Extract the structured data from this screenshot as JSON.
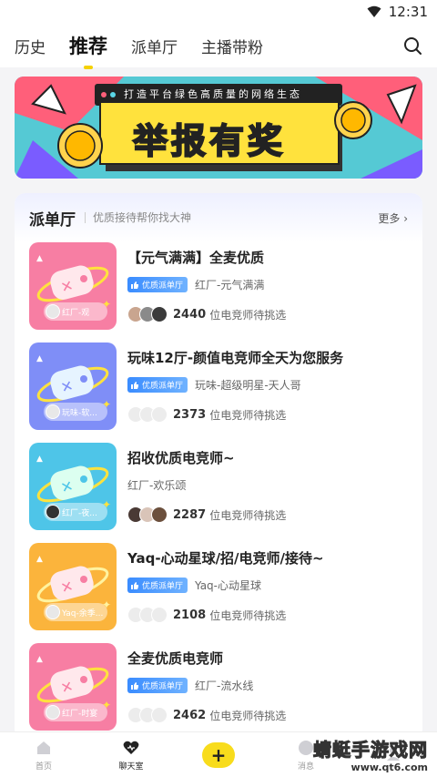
{
  "status_bar": {
    "time": "12:31"
  },
  "tabs": [
    {
      "label": "历史"
    },
    {
      "label": "推荐"
    },
    {
      "label": "派单厅"
    },
    {
      "label": "主播带粉"
    }
  ],
  "banner": {
    "slogan": "打造平台绿色高质量的网络生态",
    "headline": "举报有奖"
  },
  "panel": {
    "title": "派单厅",
    "subtitle": "优质接待帮你找大神",
    "more": "更多"
  },
  "badge_text": "优质派单厅",
  "count_suffix": "位电竞师待挑选",
  "rooms": [
    {
      "title": "【元气满满】全麦优质",
      "badge": "优质派单厅",
      "host": "红厂-元气满满",
      "count": "2440",
      "suffix": "位电竞师待挑选",
      "tag": "红厂-观",
      "color": "#f77ea3"
    },
    {
      "title": "玩味12厅-颜值电竞师全天为您服务",
      "badge": "优质派单厅",
      "host": "玩味-超级明星-天人哥",
      "count": "2373",
      "suffix": "位电竞师待挑选",
      "tag": "玩味-软...",
      "color": "#7f8ef7"
    },
    {
      "title": "招收优质电竞师~",
      "badge": "",
      "host": "红厂-欢乐颂",
      "count": "2287",
      "suffix": "位电竞师待挑选",
      "tag": "红厂-夜...",
      "color": "#4ec5e8"
    },
    {
      "title": "Yaq-心动星球/招/电竞师/接待~",
      "badge": "优质派单厅",
      "host": "Yaq-心动星球",
      "count": "2108",
      "suffix": "位电竞师待挑选",
      "tag": "Yaq-余季...",
      "color": "#fbb43c"
    },
    {
      "title": "全麦优质电竞师",
      "badge": "优质派单厅",
      "host": "红厂-流水线",
      "count": "2462",
      "suffix": "位电竞师待挑选",
      "tag": "红厂-时宴",
      "color": "#f77ea3"
    }
  ],
  "bottom_nav": [
    {
      "label": "首页"
    },
    {
      "label": "聊天室"
    },
    {
      "label": "+"
    },
    {
      "label": "消息"
    },
    {
      "label": ""
    }
  ],
  "watermark": {
    "main": "蜻蜓手游戏网",
    "url": "www.qt6.com"
  }
}
